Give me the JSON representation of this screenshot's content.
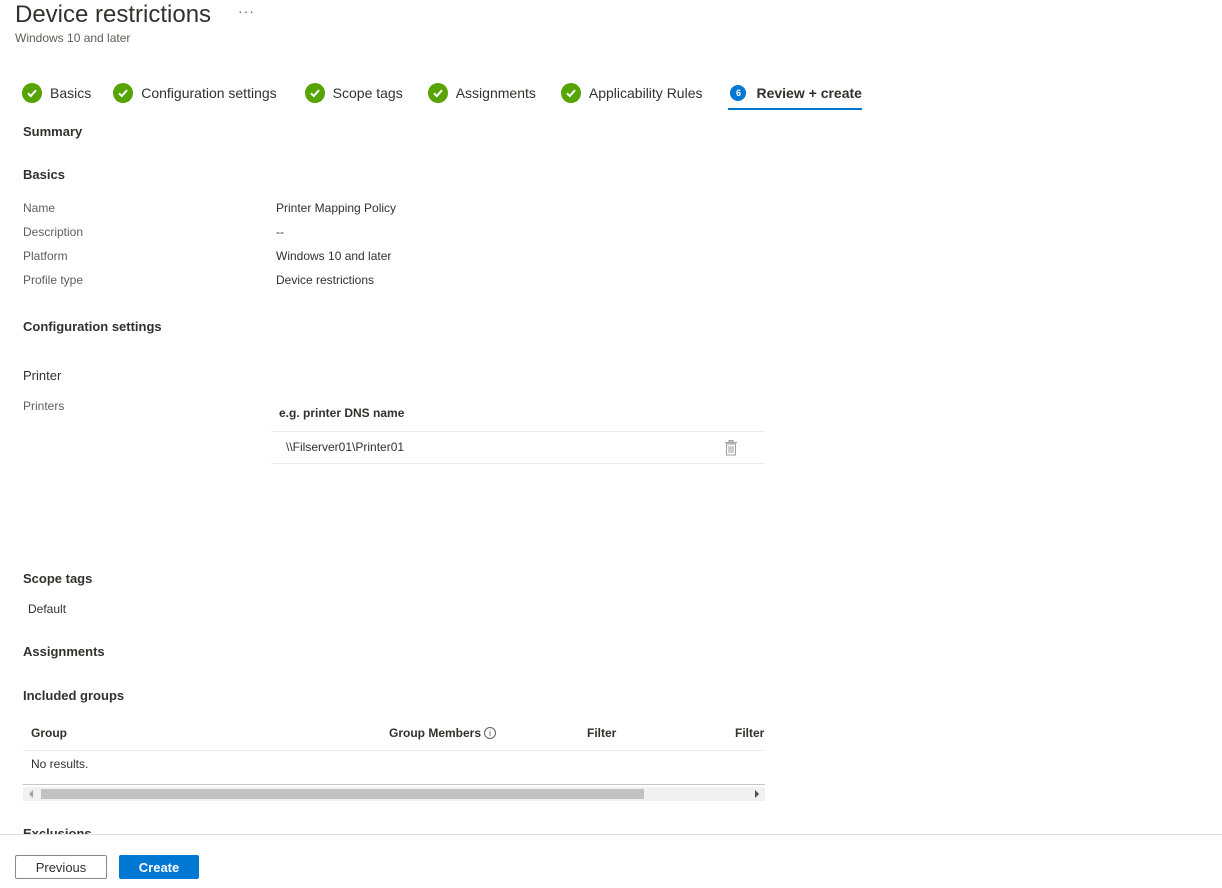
{
  "header": {
    "title": "Device restrictions",
    "more": "···",
    "subtitle": "Windows 10 and later"
  },
  "steps": [
    {
      "label": "Basics",
      "state": "complete"
    },
    {
      "label": "Configuration settings",
      "state": "complete"
    },
    {
      "label": "Scope tags",
      "state": "complete"
    },
    {
      "label": "Assignments",
      "state": "complete"
    },
    {
      "label": "Applicability Rules",
      "state": "complete"
    },
    {
      "label": "Review + create",
      "state": "active",
      "number": "6"
    }
  ],
  "summary": {
    "heading": "Summary",
    "basics": {
      "heading": "Basics",
      "rows": [
        {
          "label": "Name",
          "value": "Printer Mapping Policy"
        },
        {
          "label": "Description",
          "value": "--"
        },
        {
          "label": "Platform",
          "value": "Windows 10 and later"
        },
        {
          "label": "Profile type",
          "value": "Device restrictions"
        }
      ]
    },
    "configuration": {
      "heading": "Configuration settings",
      "category": "Printer",
      "printers_label": "Printers",
      "column_header": "e.g. printer DNS name",
      "printers": [
        "\\\\Filserver01\\Printer01"
      ]
    },
    "scope_tags": {
      "heading": "Scope tags",
      "value": "Default"
    },
    "assignments": {
      "heading": "Assignments",
      "included_heading": "Included groups",
      "columns": [
        "Group",
        "Group Members",
        "Filter",
        "Filter"
      ],
      "empty": "No results."
    },
    "next_heading_partial": "Exclusions"
  },
  "footer": {
    "previous": "Previous",
    "create": "Create"
  },
  "colors": {
    "accent": "#0078d4",
    "success": "#57a300"
  }
}
